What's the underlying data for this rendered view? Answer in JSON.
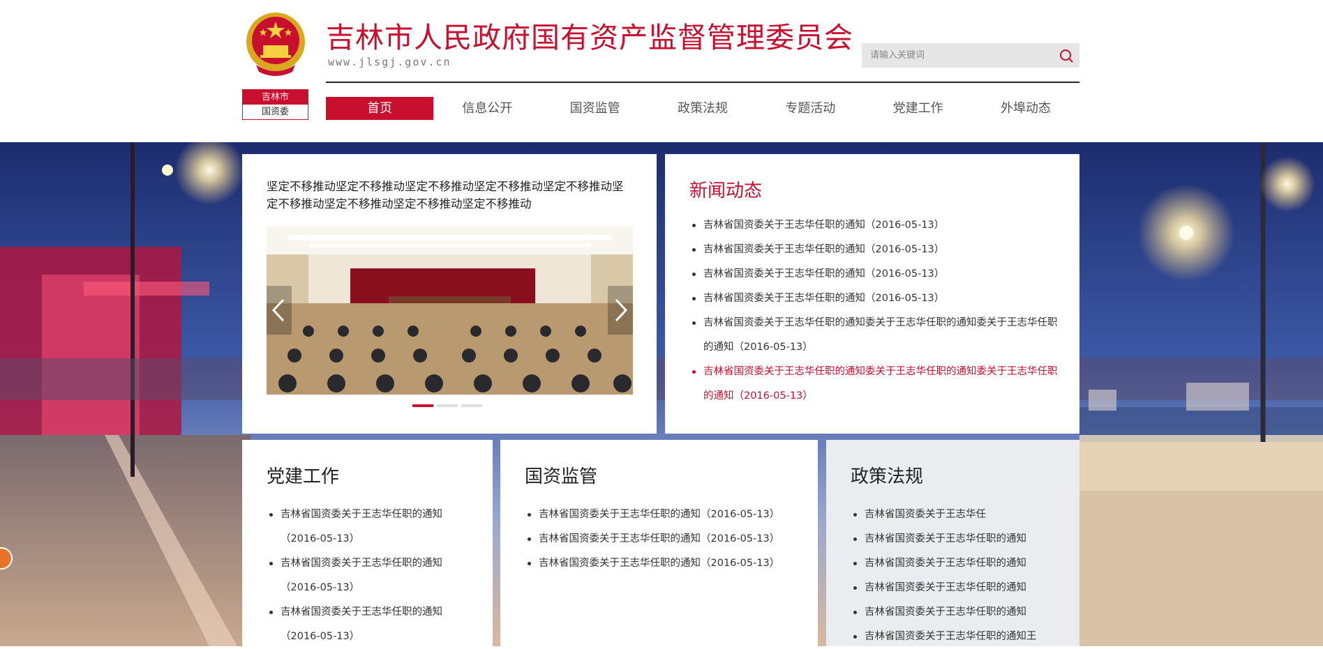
{
  "header": {
    "unit_badge_top": "吉林市",
    "unit_badge_bottom": "国资委",
    "title": "吉林市人民政府国有资产监督管理委员会",
    "url": "www.jlsgj.gov.cn",
    "search_placeholder": "请输入关键词",
    "brand_color": "#c8102e"
  },
  "nav": {
    "items": [
      {
        "label": "首页",
        "active": true
      },
      {
        "label": "信息公开"
      },
      {
        "label": "国资监管"
      },
      {
        "label": "政策法规"
      },
      {
        "label": "专题活动"
      },
      {
        "label": "党建工作"
      },
      {
        "label": "外埠动态"
      }
    ]
  },
  "carousel": {
    "caption": "坚定不移推动坚定不移推动坚定不移推动坚定不移推动坚定不移推动坚定不移推动坚定不移推动坚定不移推动坚定不移推动",
    "slide_count": 3,
    "active_slide": 1
  },
  "news": {
    "title": "新闻动态",
    "items": [
      "吉林省国资委关于王志华任职的通知（2016-05-13）",
      "吉林省国资委关于王志华任职的通知（2016-05-13）",
      "吉林省国资委关于王志华任职的通知（2016-05-13）",
      "吉林省国资委关于王志华任职的通知（2016-05-13）",
      "吉林省国资委关于王志华任职的通知委关于王志华任职的通知委关于王志华任职的通知（2016-05-13）",
      "吉林省国资委关于王志华任职的通知委关于王志华任职的通知委关于王志华任职的通知（2016-05-13）"
    ]
  },
  "party": {
    "title": "党建工作",
    "items": [
      "吉林省国资委关于王志华任职的通知（2016-05-13）",
      "吉林省国资委关于王志华任职的通知（2016-05-13）",
      "吉林省国资委关于王志华任职的通知（2016-05-13）"
    ]
  },
  "state": {
    "title": "国资监管",
    "items": [
      "吉林省国资委关于王志华任职的通知（2016-05-13）",
      "吉林省国资委关于王志华任职的通知（2016-05-13）",
      "吉林省国资委关于王志华任职的通知（2016-05-13）"
    ]
  },
  "policy": {
    "title": "政策法规",
    "items": [
      "吉林省国资委关于王志华任",
      "吉林省国资委关于王志华任职的通知",
      "吉林省国资委关于王志华任职的通知",
      "吉林省国资委关于王志华任职的通知",
      "吉林省国资委关于王志华任职的通知",
      "吉林省国资委关于王志华任职的通知王"
    ]
  }
}
